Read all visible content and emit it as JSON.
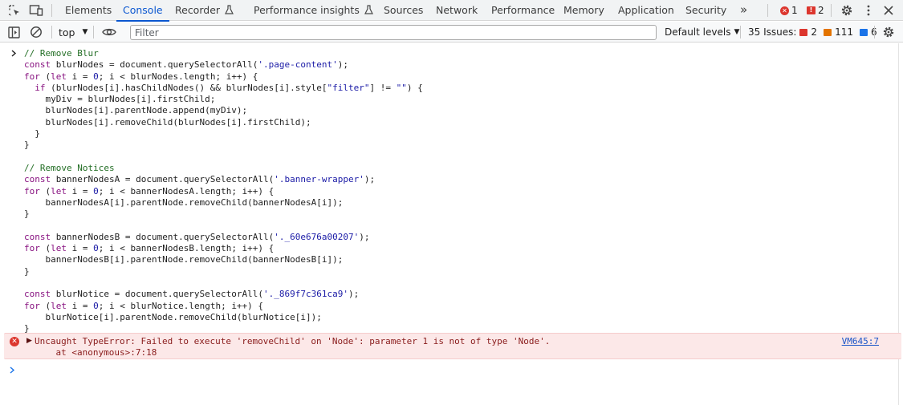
{
  "tabs": [
    {
      "label": "Elements"
    },
    {
      "label": "Console"
    },
    {
      "label": "Recorder"
    },
    {
      "label": "Performance insights"
    },
    {
      "label": "Sources"
    },
    {
      "label": "Network"
    },
    {
      "label": "Performance"
    },
    {
      "label": "Memory"
    },
    {
      "label": "Application"
    },
    {
      "label": "Security"
    }
  ],
  "active_tab": "Console",
  "more_tabs_glyph": "»",
  "tab_badges": {
    "errors": "1",
    "warnings": "2"
  },
  "toolbar": {
    "context": "top",
    "filter_placeholder": "Filter",
    "filter_value": "",
    "levels_label": "Default levels",
    "issues_label": "35 Issues:",
    "issues_errors": "2",
    "issues_warnings": "111",
    "issues_info": "6"
  },
  "console": {
    "code": [
      [
        [
          "cm",
          "// Remove Blur"
        ]
      ],
      [
        [
          "kw",
          "const"
        ],
        [
          "vr",
          " blurNodes = document.querySelectorAll("
        ],
        [
          "st",
          "'.page-content'"
        ],
        [
          "vr",
          ");"
        ]
      ],
      [
        [
          "kw",
          "for"
        ],
        [
          "vr",
          " ("
        ],
        [
          "kw",
          "let"
        ],
        [
          "vr",
          " i = "
        ],
        [
          "nm",
          "0"
        ],
        [
          "vr",
          "; i < blurNodes.length; i++) {"
        ]
      ],
      [
        [
          "vr",
          "  "
        ],
        [
          "kw",
          "if"
        ],
        [
          "vr",
          " (blurNodes[i].hasChildNodes() && blurNodes[i].style["
        ],
        [
          "st",
          "\"filter\""
        ],
        [
          "vr",
          "] != "
        ],
        [
          "st",
          "\"\""
        ],
        [
          "vr",
          ") {"
        ]
      ],
      [
        [
          "vr",
          "    myDiv = blurNodes[i].firstChild;"
        ]
      ],
      [
        [
          "vr",
          "    blurNodes[i].parentNode.append(myDiv);"
        ]
      ],
      [
        [
          "vr",
          "    blurNodes[i].removeChild(blurNodes[i].firstChild);"
        ]
      ],
      [
        [
          "vr",
          "  }"
        ]
      ],
      [
        [
          "vr",
          "}"
        ]
      ],
      [],
      [
        [
          "cm",
          "// Remove Notices"
        ]
      ],
      [
        [
          "kw",
          "const"
        ],
        [
          "vr",
          " bannerNodesA = document.querySelectorAll("
        ],
        [
          "st",
          "'.banner-wrapper'"
        ],
        [
          "vr",
          ");"
        ]
      ],
      [
        [
          "kw",
          "for"
        ],
        [
          "vr",
          " ("
        ],
        [
          "kw",
          "let"
        ],
        [
          "vr",
          " i = "
        ],
        [
          "nm",
          "0"
        ],
        [
          "vr",
          "; i < bannerNodesA.length; i++) {"
        ]
      ],
      [
        [
          "vr",
          "    bannerNodesA[i].parentNode.removeChild(bannerNodesA[i]);"
        ]
      ],
      [
        [
          "vr",
          "}"
        ]
      ],
      [],
      [
        [
          "kw",
          "const"
        ],
        [
          "vr",
          " bannerNodesB = document.querySelectorAll("
        ],
        [
          "st",
          "'._60e676a00207'"
        ],
        [
          "vr",
          ");"
        ]
      ],
      [
        [
          "kw",
          "for"
        ],
        [
          "vr",
          " ("
        ],
        [
          "kw",
          "let"
        ],
        [
          "vr",
          " i = "
        ],
        [
          "nm",
          "0"
        ],
        [
          "vr",
          "; i < bannerNodesB.length; i++) {"
        ]
      ],
      [
        [
          "vr",
          "    bannerNodesB[i].parentNode.removeChild(bannerNodesB[i]);"
        ]
      ],
      [
        [
          "vr",
          "}"
        ]
      ],
      [],
      [
        [
          "kw",
          "const"
        ],
        [
          "vr",
          " blurNotice = document.querySelectorAll("
        ],
        [
          "st",
          "'._869f7c361ca9'"
        ],
        [
          "vr",
          ");"
        ]
      ],
      [
        [
          "kw",
          "for"
        ],
        [
          "vr",
          " ("
        ],
        [
          "kw",
          "let"
        ],
        [
          "vr",
          " i = "
        ],
        [
          "nm",
          "0"
        ],
        [
          "vr",
          "; i < blurNotice.length; i++) {"
        ]
      ],
      [
        [
          "vr",
          "    blurNotice[i].parentNode.removeChild(blurNotice[i]);"
        ]
      ],
      [
        [
          "vr",
          "}"
        ]
      ]
    ],
    "error": {
      "message": "Uncaught TypeError: Failed to execute 'removeChild' on 'Node': parameter 1 is not of type 'Node'.",
      "stack": "    at <anonymous>:7:18",
      "location": "VM645:7"
    }
  },
  "colors": {
    "accent": "#0b57d0",
    "error_bg": "#fce8e8",
    "error_text": "#8a1c1c",
    "keyword": "#881280",
    "comment": "#236e25",
    "string": "#1a1aa6"
  }
}
